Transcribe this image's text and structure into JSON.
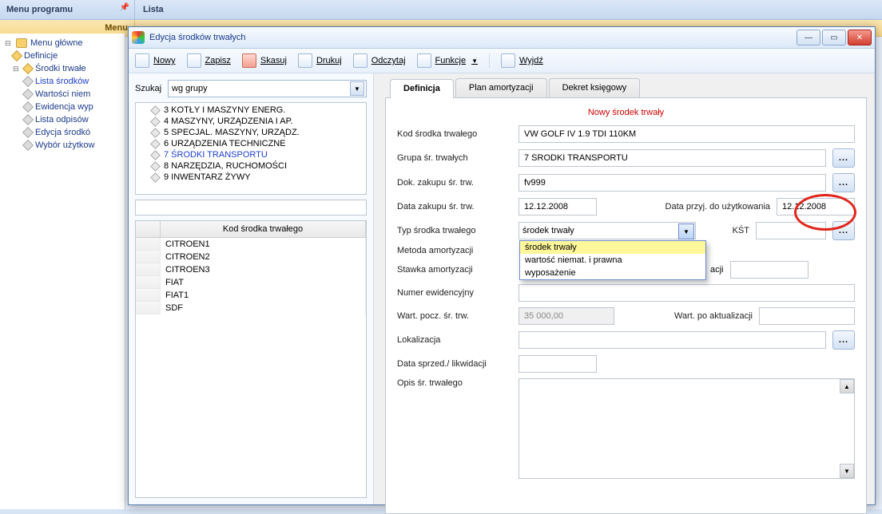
{
  "host": {
    "menu_panel_title": "Menu programu",
    "list_tab_title": "Lista",
    "menu_strip_label": "Menu"
  },
  "tree": {
    "root": "Menu główne",
    "definicje": "Definicje",
    "srodki": "Środki trwałe",
    "items": [
      "Lista środków",
      "Wartości niem",
      "Ewidencja wyp",
      "Lista odpisów",
      "Edycja środkó",
      "Wybór użytkow"
    ]
  },
  "dialog": {
    "title": "Edycja środków trwałych"
  },
  "toolbar": {
    "nowy": "Nowy",
    "zapisz": "Zapisz",
    "skasuj": "Skasuj",
    "drukuj": "Drukuj",
    "odczytaj": "Odczytaj",
    "funkcje": "Funkcje",
    "wyjdz": "Wyjdź"
  },
  "search": {
    "label": "Szukaj",
    "combo_value": "wg grupy"
  },
  "groups": [
    "3 KOTŁY I MASZYNY ENERG.",
    "4 MASZYNY, URZĄDZENIA I AP.",
    "5 SPECJAL. MASZYNY, URZĄDZ.",
    "6 URZĄDZENIA TECHNICZNE",
    "7 ŚRODKI TRANSPORTU",
    "8 NARZĘDZIA, RUCHOMOŚCI",
    "9 INWENTARZ ŻYWY"
  ],
  "groups_selected_index": 4,
  "kod_table": {
    "header": "Kod środka trwałego",
    "rows": [
      "CITROEN1",
      "CITROEN2",
      "CITROEN3",
      "FIAT",
      "FIAT1",
      "SDF"
    ]
  },
  "tabs": {
    "definicja": "Definicja",
    "plan": "Plan amortyzacji",
    "dekret": "Dekret księgowy"
  },
  "form": {
    "title": "Nowy środek trwały",
    "labels": {
      "kod": "Kod środka trwałego",
      "grupa": "Grupa śr. trwałych",
      "dok": "Dok. zakupu śr. trw.",
      "data_zak": "Data zakupu śr. trw.",
      "data_przyj": "Data przyj. do użytkowania",
      "typ": "Typ środka trwałego",
      "kst": "KŚT",
      "metoda": "Metoda amortyzacji",
      "stawka": "Stawka amortyzacji",
      "acji_suffix": "acji",
      "numer": "Numer ewidencyjny",
      "wart_pocz": "Wart. pocz. śr. trw.",
      "wart_po": "Wart. po aktualizacji",
      "lokalizacja": "Lokalizacja",
      "data_sprzed": "Data sprzed./ likwidacji",
      "opis": "Opis śr. trwałego"
    },
    "values": {
      "kod": "VW GOLF IV 1.9 TDI 110KM",
      "grupa": "7 ŚRODKI TRANSPORTU",
      "dok": "fv999",
      "data_zak": "12.12.2008",
      "data_przyj": "12.12.2008",
      "typ": "środek trwały",
      "wart_pocz": "35 000,00"
    },
    "typ_options": [
      "środek trwały",
      "wartość niemat. i prawna",
      "wyposażenie"
    ]
  }
}
